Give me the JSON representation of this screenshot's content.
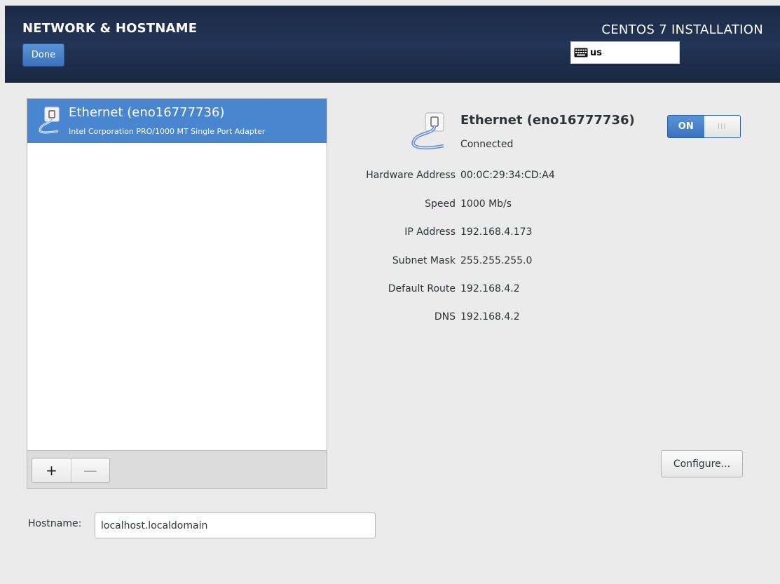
{
  "header": {
    "title": "NETWORK & HOSTNAME",
    "done_label": "Done",
    "product": "CENTOS 7 INSTALLATION",
    "keyboard_layout": "us"
  },
  "device_list": {
    "items": [
      {
        "name": "Ethernet (eno16777736)",
        "description": "Intel Corporation PRO/1000 MT Single Port Adapter",
        "selected": true
      }
    ],
    "add_label": "+",
    "remove_label": "—"
  },
  "details": {
    "name": "Ethernet (eno16777736)",
    "status": "Connected",
    "toggle_label": "ON",
    "toggle_knob": "III",
    "rows": [
      {
        "label": "Hardware Address",
        "value": "00:0C:29:34:CD:A4"
      },
      {
        "label": "Speed",
        "value": "1000 Mb/s"
      },
      {
        "label": "IP Address",
        "value": "192.168.4.173"
      },
      {
        "label": "Subnet Mask",
        "value": "255.255.255.0"
      },
      {
        "label": "Default Route",
        "value": "192.168.4.2"
      },
      {
        "label": "DNS",
        "value": "192.168.4.2"
      }
    ],
    "configure_label": "Configure..."
  },
  "hostname": {
    "label": "Hostname:",
    "value": "localhost.localdomain"
  },
  "colors": {
    "header_bg": "#1f3050",
    "accent": "#4a86cf",
    "window_bg": "#ebebeb"
  }
}
